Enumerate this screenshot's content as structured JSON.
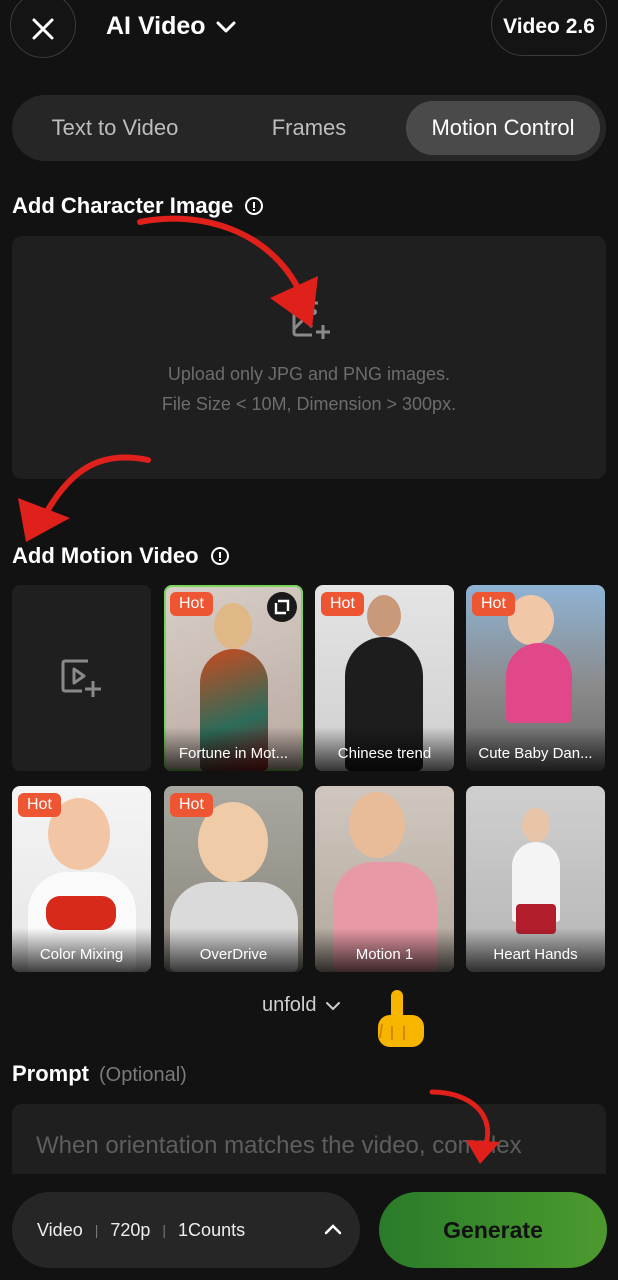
{
  "header": {
    "title": "AI Video",
    "version_label": "Video 2.6"
  },
  "tabs": [
    {
      "label": "Text to Video",
      "active": false
    },
    {
      "label": "Frames",
      "active": false
    },
    {
      "label": "Motion Control",
      "active": true
    }
  ],
  "character": {
    "title": "Add Character Image",
    "hint_line1": "Upload only JPG and PNG images.",
    "hint_line2": "File Size < 10M, Dimension > 300px."
  },
  "motion": {
    "title": "Add Motion Video",
    "templates": [
      {
        "name": "Fortune in Mot...",
        "badge": "Hot",
        "selected": true
      },
      {
        "name": "Chinese trend",
        "badge": "Hot",
        "selected": false
      },
      {
        "name": "Cute Baby Dan...",
        "badge": "Hot",
        "selected": false
      },
      {
        "name": "Color Mixing",
        "badge": "Hot",
        "selected": false
      },
      {
        "name": "OverDrive",
        "badge": "Hot",
        "selected": false
      },
      {
        "name": "Motion 1",
        "badge": "",
        "selected": false
      },
      {
        "name": "Heart Hands",
        "badge": "",
        "selected": false
      }
    ],
    "unfold_label": "unfold"
  },
  "prompt": {
    "title": "Prompt",
    "optional_label": "(Optional)",
    "placeholder": "When orientation matches the video, complex"
  },
  "footer": {
    "mode": "Video",
    "resolution": "720p",
    "counts": "1Counts",
    "generate_label": "Generate"
  },
  "colors": {
    "hot_badge": "#ee5533",
    "generate_start": "#2a7b2a",
    "generate_end": "#4c9a2e",
    "selected_outline": "#7ad65a",
    "annotation_arrow": "#e0201a"
  }
}
